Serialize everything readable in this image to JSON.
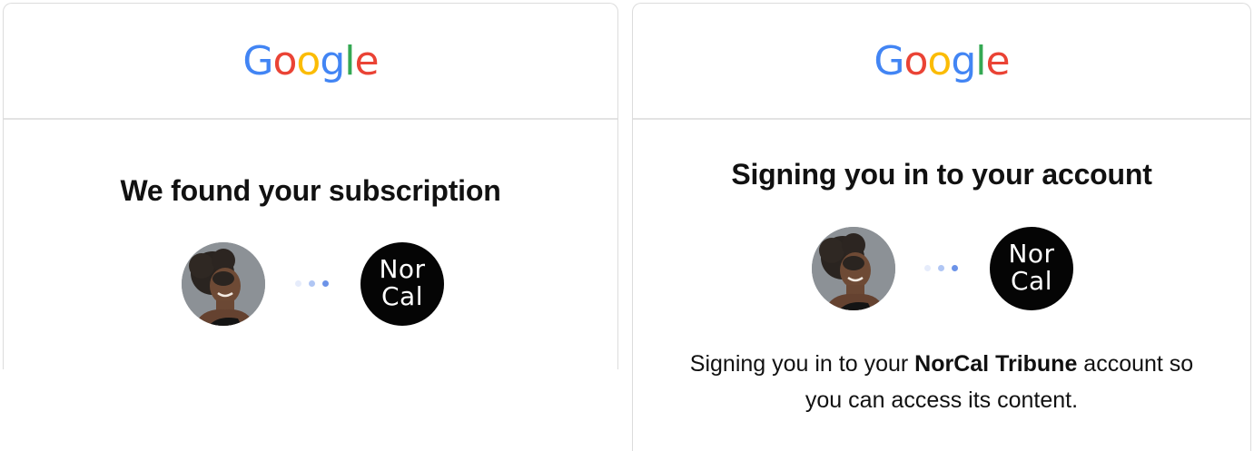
{
  "colors": {
    "google_blue": "#4285F4",
    "google_red": "#EA4335",
    "google_yellow": "#FBBC05",
    "google_green": "#34A853",
    "brand_badge_bg": "#050505",
    "divider": "#e3e3e3"
  },
  "cards": [
    {
      "logo": [
        "G",
        "o",
        "o",
        "g",
        "l",
        "e"
      ],
      "title": "We found your subscription",
      "user_avatar": "user-avatar",
      "connector": "loading-dots",
      "brand_badge": {
        "line1": "Nor",
        "line2": "Cal"
      }
    },
    {
      "logo": [
        "G",
        "o",
        "o",
        "g",
        "l",
        "e"
      ],
      "title": "Signing you in to your account",
      "user_avatar": "user-avatar",
      "connector": "loading-dots",
      "brand_badge": {
        "line1": "Nor",
        "line2": "Cal"
      },
      "message": {
        "prefix": "Signing you in to your ",
        "publication": "NorCal Tribune",
        "suffix": " account so",
        "line2": "you can access its content."
      }
    }
  ]
}
